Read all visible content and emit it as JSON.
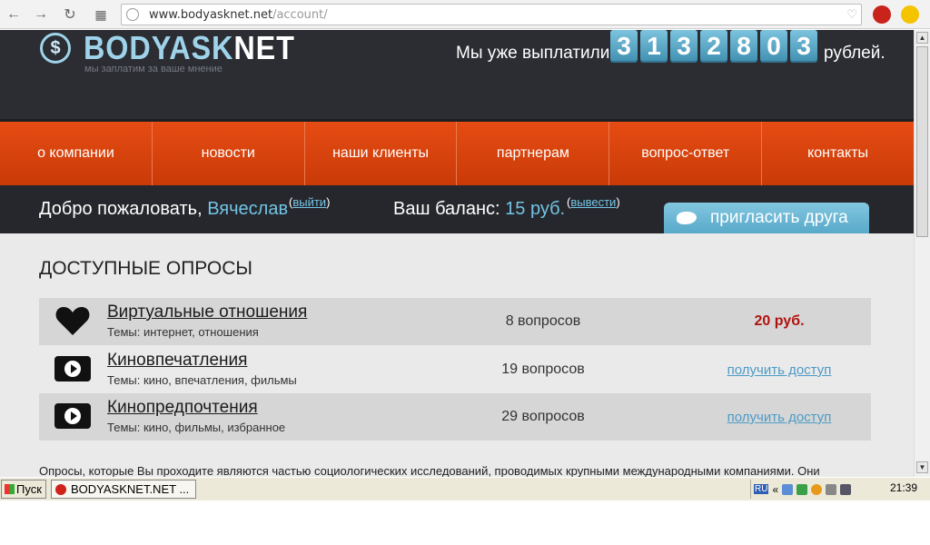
{
  "browser": {
    "url_domain": "www.bodyasknet.net",
    "url_path": "/account/",
    "icons": [
      "back-icon",
      "forward-icon",
      "reload-icon",
      "apps-icon",
      "site-info-icon",
      "star-icon",
      "extension-icon",
      "ruble-icon"
    ]
  },
  "header": {
    "logo_symbol": "$",
    "logo_main": "BODYASK",
    "logo_net": "NET",
    "tagline": "мы заплатим за ваше мнение",
    "paid_label": "Мы уже выплатили",
    "counter_digits": [
      "3",
      "1",
      "3",
      "2",
      "8",
      "0",
      "3"
    ],
    "currency_label": "рублей."
  },
  "nav": {
    "items": [
      "о компании",
      "новости",
      "наши клиенты",
      "партнерам",
      "вопрос-ответ",
      "контакты"
    ]
  },
  "welcome": {
    "greeting": "Добро пожаловать,",
    "username": "Вячеслав",
    "logout_open": "(",
    "logout_link": "выйти",
    "logout_close": ")",
    "balance_label": "Ваш баланс:",
    "balance_value": "15 руб.",
    "withdraw_open": "(",
    "withdraw_link": "вывести",
    "withdraw_close": ")",
    "invite_label": "пригласить друга"
  },
  "surveys": {
    "title": "ДОСТУПНЫЕ ОПРОСЫ",
    "rows": [
      {
        "icon": "heart-icon",
        "title": "Виртуальные отношения",
        "topics": "Темы: интернет, отношения",
        "count": "8 вопросов",
        "price": "20 руб."
      },
      {
        "icon": "video-play-icon",
        "title": "Киновпечатления",
        "topics": "Темы: кино, впечатления, фильмы",
        "count": "19 вопросов",
        "access": "получить доступ"
      },
      {
        "icon": "video-play-icon",
        "title": "Кинопредпочтения",
        "topics": "Темы: кино, фильмы, избранное",
        "count": "29 вопросов",
        "access": "получить доступ"
      }
    ],
    "footnote": "Опросы, которые Вы проходите являются частью социологических исследований, проводимых крупными международными компаниями. Они"
  },
  "taskbar": {
    "start_label": "Пуск",
    "task_label": "BODYASKNET.NET ...",
    "lang": "RU",
    "tray_chevron": "«",
    "clock": "21:39"
  },
  "colors": {
    "header_bg": "#2b2d33",
    "nav_orange": "#e64c13",
    "accent_blue": "#73c4e6",
    "price_red": "#b0120e"
  }
}
